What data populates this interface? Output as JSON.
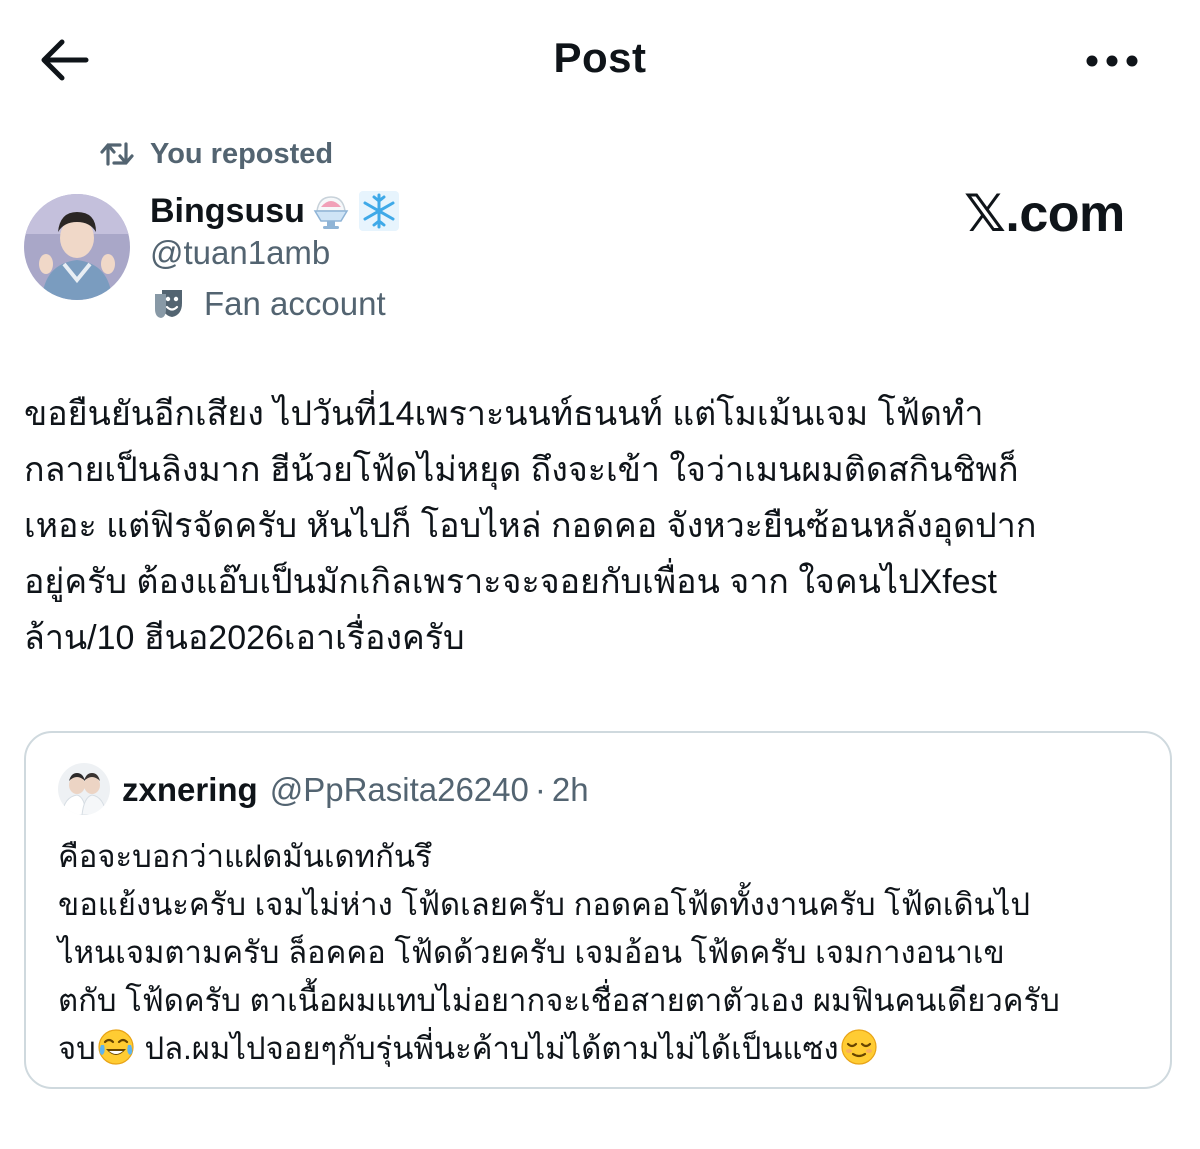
{
  "header": {
    "title": "Post"
  },
  "repost": {
    "text": "You reposted"
  },
  "author": {
    "display_name": "Bingsusu",
    "handle": "@tuan1amb",
    "label": "Fan account"
  },
  "watermark": "𝕏.com",
  "post": {
    "text": "ขอยืนยันอีกเสียง  ไปวันที่14เพราะนนท์ธนนท์ แต่โมเม้นเจม โฟ้ดทำ\nกลายเป็นลิงมาก ฮีน้วยโฟ้ดไม่หยุด ถึงจะเข้า ใจว่าเมนผมติดสกินชิพก็\nเหอะ แต่ฟิรจัดครับ หันไปก็ โอบไหล่ กอดคอ จังหวะยืนซ้อนหลังอุดปาก\nอยู่ครับ ต้องแอ๊บเป็นมักเกิลเพราะจะจอยกับเพื่อน จาก ใจคนไปXfest\nล้าน/10 ฮีนอ2026เอาเรื่องครับ"
  },
  "quote": {
    "display_name": "zxnering",
    "handle": "@PpRasita26240",
    "separator": "·",
    "time": "2h",
    "text_main": "คือจะบอกว่าแฝดมันเดทกันรึ\nขอแย้งนะครับ เจมไม่ห่าง โฟ้ดเลยครับ กอดคอโฟ้ดทั้งงานครับ โฟ้ดเดินไป\nไหนเจมตามครับ ล็อคคอ โฟ้ดด้วยครับ เจมอ้อน โฟ้ดครับ เจมกางอนาเข\nตกับ โฟ้ดครับ ตาเนื้อผมแทบไม่อยากจะเชื่อสายตาตัวเอง ผมฟินคนเดียวครับ\nจบ",
    "text_tail": " ปล.ผมไปจอยๆกับรุ่นพี่นะค้าบไม่ได้ตามไม่ได้เป็นแซง"
  },
  "colors": {
    "text": "#0f1419",
    "secondary": "#536471",
    "border": "#cfd9de"
  },
  "icons": {
    "back": "arrow-left-icon",
    "more": "ellipsis-icon",
    "repost": "repost-icon",
    "label": "theater-mask-icon",
    "name_emoji": "shaved-ice-emoji",
    "name_emoji_2": "snowflake-emoji",
    "quote_emoji_1": "tears-of-joy-emoji",
    "quote_emoji_2": "relieved-face-emoji"
  }
}
